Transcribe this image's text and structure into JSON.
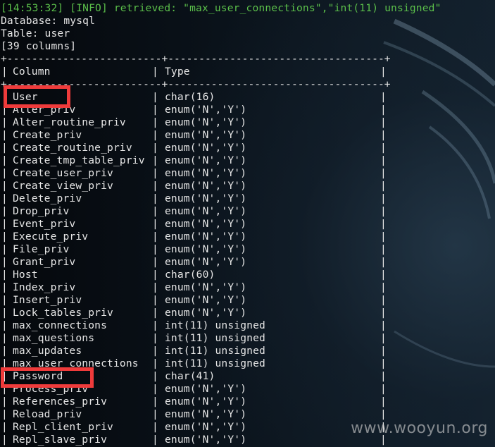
{
  "terminal": {
    "info_line": "[14:53:32] [INFO] retrieved: \"max_user_connections\",\"int(11) unsigned\"",
    "database_line": "Database: mysql",
    "table_line": "Table: user",
    "columns_count_line": "[39 columns]",
    "separator": "+-------------------------+-----------------------------------+",
    "header": {
      "column": "Column",
      "type": "Type"
    },
    "rows": [
      {
        "column": "User",
        "type": "char(16)"
      },
      {
        "column": "Alter_priv",
        "type": "enum('N','Y')"
      },
      {
        "column": "Alter_routine_priv",
        "type": "enum('N','Y')"
      },
      {
        "column": "Create_priv",
        "type": "enum('N','Y')"
      },
      {
        "column": "Create_routine_priv",
        "type": "enum('N','Y')"
      },
      {
        "column": "Create_tmp_table_priv",
        "type": "enum('N','Y')"
      },
      {
        "column": "Create_user_priv",
        "type": "enum('N','Y')"
      },
      {
        "column": "Create_view_priv",
        "type": "enum('N','Y')"
      },
      {
        "column": "Delete_priv",
        "type": "enum('N','Y')"
      },
      {
        "column": "Drop_priv",
        "type": "enum('N','Y')"
      },
      {
        "column": "Event_priv",
        "type": "enum('N','Y')"
      },
      {
        "column": "Execute_priv",
        "type": "enum('N','Y')"
      },
      {
        "column": "File_priv",
        "type": "enum('N','Y')"
      },
      {
        "column": "Grant_priv",
        "type": "enum('N','Y')"
      },
      {
        "column": "Host",
        "type": "char(60)"
      },
      {
        "column": "Index_priv",
        "type": "enum('N','Y')"
      },
      {
        "column": "Insert_priv",
        "type": "enum('N','Y')"
      },
      {
        "column": "Lock_tables_priv",
        "type": "enum('N','Y')"
      },
      {
        "column": "max_connections",
        "type": "int(11) unsigned"
      },
      {
        "column": "max_questions",
        "type": "int(11) unsigned"
      },
      {
        "column": "max_updates",
        "type": "int(11) unsigned"
      },
      {
        "column": "max_user_connections",
        "type": "int(11) unsigned"
      },
      {
        "column": "Password",
        "type": "char(41)"
      },
      {
        "column": "Process_priv",
        "type": "enum('N','Y')"
      },
      {
        "column": "References_priv",
        "type": "enum('N','Y')"
      },
      {
        "column": "Reload_priv",
        "type": "enum('N','Y')"
      },
      {
        "column": "Repl_client_priv",
        "type": "enum('N','Y')"
      },
      {
        "column": "Repl_slave_priv",
        "type": "enum('N','Y')"
      }
    ],
    "highlighted_columns": [
      "User",
      "Password"
    ]
  },
  "watermark": "www.wooyun.org",
  "colors": {
    "text": "#e6e6e6",
    "info": "#5bbf4a",
    "highlight": "#ef3b3b",
    "background": "#0d1720"
  }
}
